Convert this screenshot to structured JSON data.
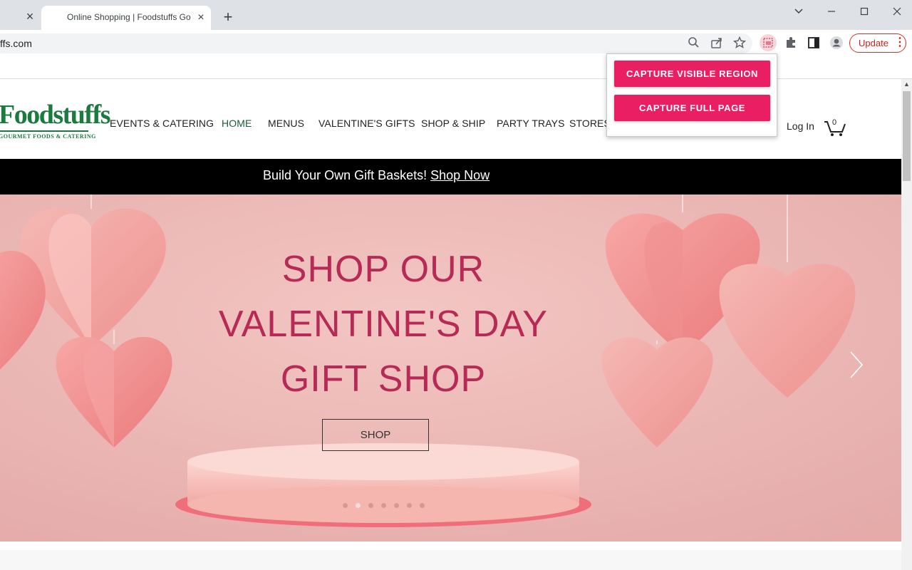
{
  "browser": {
    "tab_title": "Online Shopping | Foodstuffs Gourmet Foods & Catering",
    "url": "ffs.com",
    "update_label": "Update",
    "new_tab_glyph": "+",
    "close_glyph": "×"
  },
  "extension_popup": {
    "capture_visible_label": "CAPTURE VISIBLE REGION",
    "capture_full_label": "CAPTURE FULL PAGE",
    "accent_color": "#e91e63"
  },
  "site": {
    "logo_text": "Foodstuffs",
    "logo_tagline": "GOURMET FOODS & CATERING",
    "brand_color": "#1b7a3d",
    "nav": [
      "EVENTS & CATERING",
      "HOME",
      "MENUS",
      "VALENTINE'S GIFTS",
      "SHOP & SHIP",
      "PARTY TRAYS",
      "STORES"
    ],
    "active_nav": "HOME",
    "login_label": "Log In",
    "cart_count": "0"
  },
  "banner": {
    "text": "Build Your Own Gift Baskets!",
    "link": "Shop Now"
  },
  "hero": {
    "headline_lines": [
      "SHOP OUR",
      "VALENTINE'S DAY",
      "GIFT SHOP"
    ],
    "button_label": "SHOP",
    "slide_count": 7,
    "active_slide": 2,
    "headline_color": "#b72a55"
  }
}
